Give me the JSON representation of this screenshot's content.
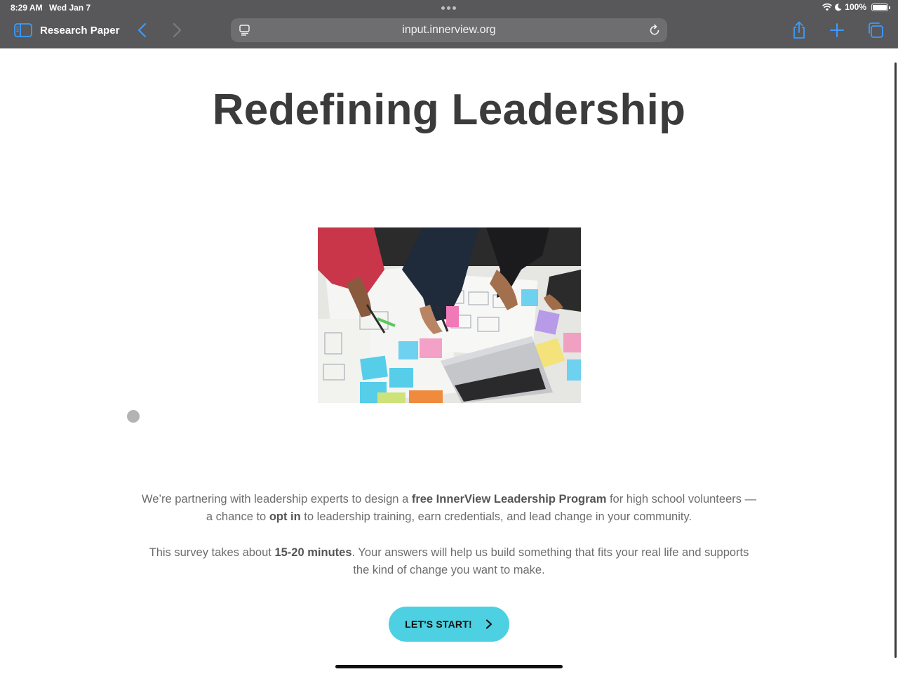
{
  "status_bar": {
    "time": "8:29 AM",
    "date": "Wed Jan 7",
    "battery": "100%",
    "battery_level": 1.0
  },
  "toolbar": {
    "tab_title": "Research Paper",
    "url": "input.innerview.org",
    "accent_color": "#3b9bff",
    "icons": [
      "sidebar-icon",
      "back-chevron-icon",
      "forward-chevron-icon",
      "reader-icon",
      "reload-icon",
      "share-icon",
      "plus-icon",
      "tabs-icon"
    ]
  },
  "page": {
    "title": "Redefining Leadership",
    "hero_image": "people-planning-with-sticky-notes-and-laptop",
    "intro": {
      "t1": "We’re partnering with leadership experts to design a ",
      "b1": "free InnerView Leadership Program",
      "t2": " for high school volunteers — a chance to ",
      "b2": "opt in",
      "t3": " to leadership training, earn credentials, and lead change in your community."
    },
    "duration": {
      "t1": "This survey takes about ",
      "b1": "15-20 minutes",
      "t2": ". Your answers will help us build something that fits your real life and supports the kind of change you want to make."
    },
    "cta": {
      "label": "LET'S START!",
      "color": "#4dd0e1"
    }
  }
}
